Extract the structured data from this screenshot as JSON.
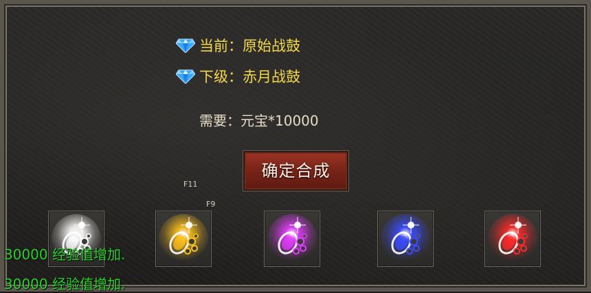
{
  "upgrade": {
    "current_label": "当前：原始战鼓",
    "next_label": "下级：赤月战鼓",
    "requirement": "需要：元宝*10000",
    "confirm_button": "确定合成"
  },
  "hotkeys": {
    "f11": "F11",
    "f9": "F9"
  },
  "item_slots": [
    {
      "icon": "war-drum-white-icon",
      "glow": "#ffffff"
    },
    {
      "icon": "war-drum-gold-icon",
      "glow": "#ffc21a"
    },
    {
      "icon": "war-drum-purple-icon",
      "glow": "#e23cff"
    },
    {
      "icon": "war-drum-blue-icon",
      "glow": "#3b4cff"
    },
    {
      "icon": "war-drum-red-icon",
      "glow": "#ff2a2a"
    }
  ],
  "messages": [
    "30000 经验值增加.",
    "30000 经验值增加."
  ],
  "colors": {
    "title_text": "#f4d94a",
    "message_text": "#2bd12b",
    "button_red": "#8a2c1e"
  }
}
